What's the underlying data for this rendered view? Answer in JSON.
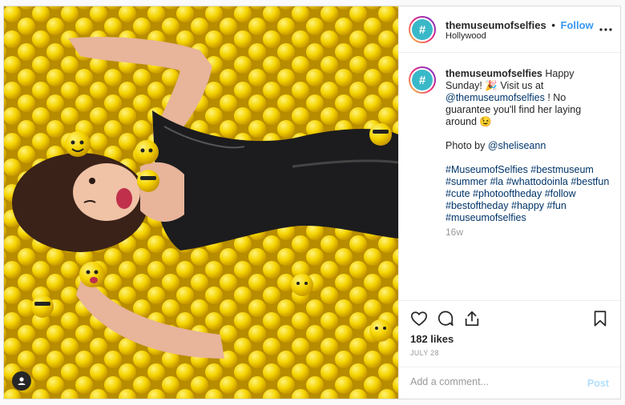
{
  "post": {
    "username": "themuseumofselfies",
    "follow_label": "Follow",
    "dot": "•",
    "location": "Hollywood",
    "more_icon": "more-icon",
    "avatar_glyph": "#"
  },
  "caption": {
    "username": "themuseumofselfies",
    "line1": " Happy Sunday!",
    "emoji_party": "🎉",
    "line2_pre": " Visit us at ",
    "mention_museum": "@themuseumofselfies",
    "line2_post": " ! No guarantee you'll find her laying around ",
    "emoji_wink": "😉",
    "photo_by": "Photo by ",
    "mention_photographer": "@sheliseann",
    "hashtags": "#MuseumofSelfies #bestmuseum #summer #la #whattodoinla #bestfun #cute #photooftheday #follow #bestoftheday #happy #fun #museumofselfies",
    "age": "16w"
  },
  "actions": {
    "like_icon": "heart-icon",
    "comment_icon": "comment-icon",
    "share_icon": "share-icon",
    "save_icon": "bookmark-icon",
    "likes": "182 likes",
    "date": "JULY 28"
  },
  "comment": {
    "placeholder": "Add a comment...",
    "post_label": "Post"
  },
  "colors": {
    "follow": "#3897f0",
    "avatar_bg": "#39b8c8",
    "ball_yellow": "#f5d400"
  }
}
